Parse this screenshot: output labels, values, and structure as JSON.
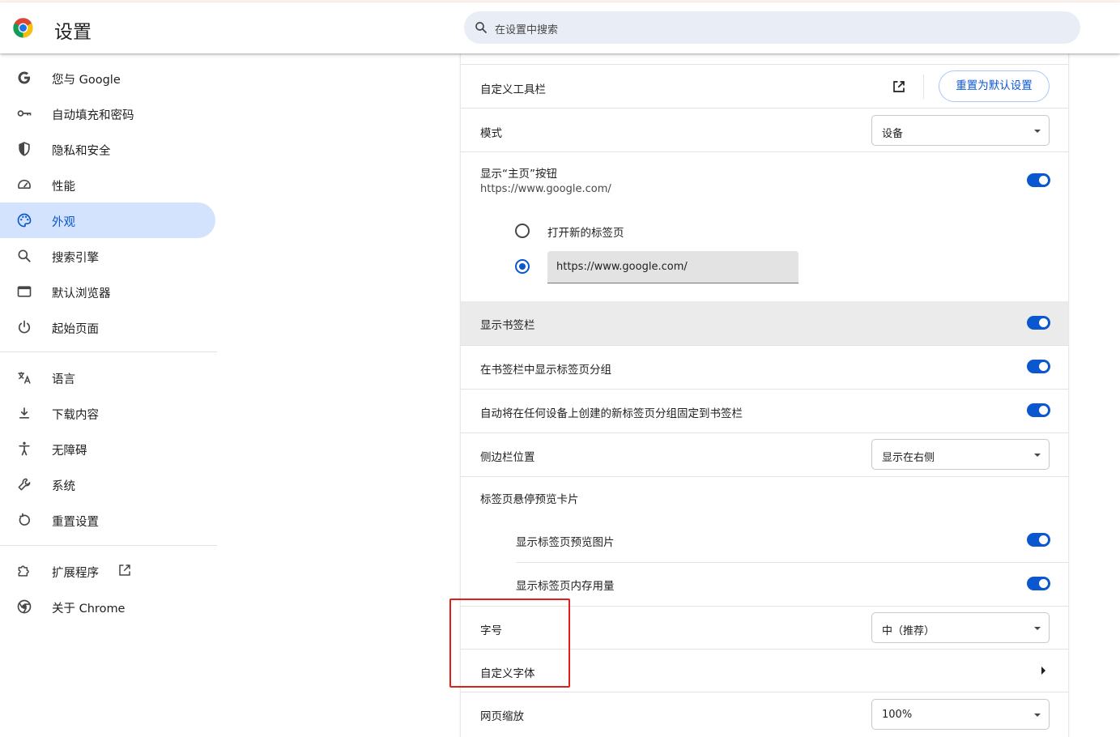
{
  "header": {
    "title": "设置",
    "search_placeholder": "在设置中搜索"
  },
  "sidebar": {
    "items": [
      {
        "label": "您与 Google",
        "icon": "google-g-icon"
      },
      {
        "label": "自动填充和密码",
        "icon": "key-icon"
      },
      {
        "label": "隐私和安全",
        "icon": "shield-icon"
      },
      {
        "label": "性能",
        "icon": "speedometer-icon"
      },
      {
        "label": "外观",
        "icon": "palette-icon",
        "active": true
      },
      {
        "label": "搜索引擎",
        "icon": "search-icon"
      },
      {
        "label": "默认浏览器",
        "icon": "browser-window-icon"
      },
      {
        "label": "起始页面",
        "icon": "power-icon"
      },
      {
        "label": "语言",
        "icon": "translate-icon"
      },
      {
        "label": "下载内容",
        "icon": "download-icon"
      },
      {
        "label": "无障碍",
        "icon": "accessibility-icon"
      },
      {
        "label": "系统",
        "icon": "wrench-icon"
      },
      {
        "label": "重置设置",
        "icon": "reset-icon"
      },
      {
        "label": "扩展程序",
        "icon": "puzzle-icon"
      },
      {
        "label": "关于 Chrome",
        "icon": "chrome-logo-icon"
      }
    ]
  },
  "appearance": {
    "customize_toolbar": {
      "label": "自定义工具栏",
      "button": "重置为默认设置"
    },
    "mode": {
      "label": "模式",
      "value": "设备"
    },
    "home_button": {
      "label": "显示“主页”按钮",
      "sub": "https://www.google.com/",
      "enabled": true
    },
    "home_options": {
      "new_tab": "打开新的标签页",
      "custom_url": "https://www.google.com/",
      "selected": "custom_url"
    },
    "bookmarks_bar": {
      "label": "显示书签栏",
      "enabled": true
    },
    "tab_groups_in_bookmarks": {
      "label": "在书签栏中显示标签页分组",
      "enabled": true
    },
    "auto_pin_groups": {
      "label": "自动将在任何设备上创建的新标签页分组固定到书签栏",
      "enabled": true
    },
    "side_panel": {
      "label": "侧边栏位置",
      "value": "显示在右侧"
    },
    "hover_card": {
      "label": "标签页悬停预览卡片"
    },
    "hover_preview_image": {
      "label": "显示标签页预览图片",
      "enabled": true
    },
    "hover_memory": {
      "label": "显示标签页内存用量",
      "enabled": true
    },
    "font_size": {
      "label": "字号",
      "value": "中（推荐）"
    },
    "custom_fonts": {
      "label": "自定义字体"
    },
    "page_zoom": {
      "label": "网页缩放",
      "value": "100%"
    }
  },
  "colors": {
    "accent": "#0b57d0",
    "active_nav_bg": "#d3e3fd",
    "highlight_box": "#e01e1e"
  }
}
